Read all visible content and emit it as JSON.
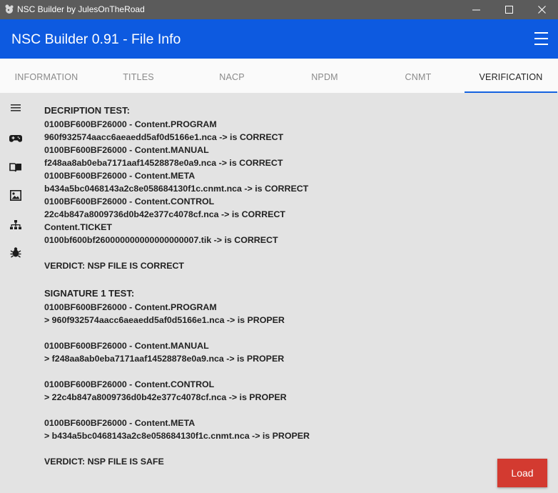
{
  "window": {
    "title": "NSC Builder by JulesOnTheRoad"
  },
  "appbar": {
    "title": "NSC Builder 0.91 - File Info",
    "menu_icon": "hamburger-icon"
  },
  "tabs": [
    {
      "label": "INFORMATION",
      "active": false
    },
    {
      "label": "TITLES",
      "active": false
    },
    {
      "label": "NACP",
      "active": false
    },
    {
      "label": "NPDM",
      "active": false
    },
    {
      "label": "CNMT",
      "active": false
    },
    {
      "label": "VERIFICATION",
      "active": true
    }
  ],
  "sidenav": [
    "list-icon",
    "gamepad-icon",
    "book-icon",
    "image-icon",
    "sitemap-icon",
    "bug-icon"
  ],
  "content": {
    "decryption": {
      "heading": "DECRIPTION TEST:",
      "lines": [
        "0100BF600BF26000 - Content.PROGRAM",
        "960f932574aacc6aeaedd5af0d5166e1.nca -> is CORRECT",
        "0100BF600BF26000 - Content.MANUAL",
        "f248aa8ab0eba7171aaf14528878e0a9.nca -> is CORRECT",
        "0100BF600BF26000 - Content.META",
        "b434a5bc0468143a2c8e058684130f1c.cnmt.nca -> is CORRECT",
        "0100BF600BF26000 - Content.CONTROL",
        "22c4b847a8009736d0b42e377c4078cf.nca -> is CORRECT",
        "Content.TICKET",
        "0100bf600bf260000000000000000007.tik -> is CORRECT"
      ],
      "verdict": "VERDICT: NSP FILE IS CORRECT"
    },
    "signature": {
      "heading": "SIGNATURE 1 TEST:",
      "blocks": [
        {
          "title": "0100BF600BF26000 - Content.PROGRAM",
          "detail": "> 960f932574aacc6aeaedd5af0d5166e1.nca -> is PROPER"
        },
        {
          "title": "0100BF600BF26000 - Content.MANUAL",
          "detail": "> f248aa8ab0eba7171aaf14528878e0a9.nca -> is PROPER"
        },
        {
          "title": "0100BF600BF26000 - Content.CONTROL",
          "detail": "> 22c4b847a8009736d0b42e377c4078cf.nca -> is PROPER"
        },
        {
          "title": "0100BF600BF26000 - Content.META",
          "detail": "> b434a5bc0468143a2c8e058684130f1c.cnmt.nca -> is PROPER"
        }
      ],
      "verdict": "VERDICT: NSP FILE IS SAFE"
    }
  },
  "load_button": {
    "label": "Load"
  },
  "colors": {
    "titlebar": "#5b5b5b",
    "appbar": "#0d5ae0",
    "tab_indicator": "#1562e0",
    "load_button": "#d33a30",
    "background": "#e3e3e3"
  }
}
